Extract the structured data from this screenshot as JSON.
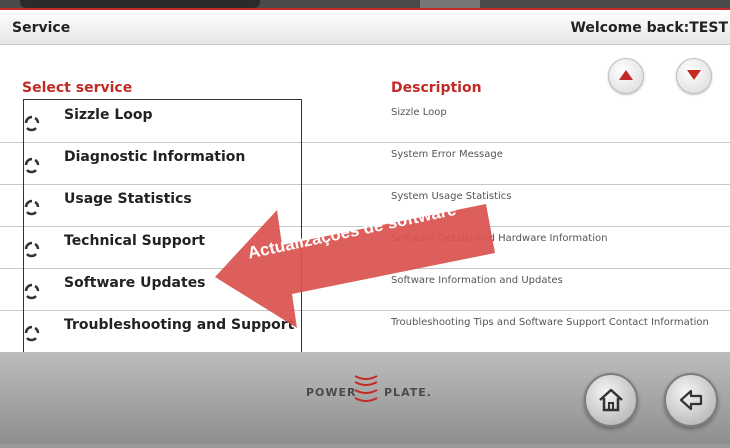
{
  "header": {
    "title": "Service",
    "welcome": "Welcome back:TEST"
  },
  "columns": {
    "service": "Select service",
    "description": "Description"
  },
  "nav": {
    "up_icon": "triangle-up-icon",
    "down_icon": "triangle-down-icon"
  },
  "services": [
    {
      "label": "Sizzle Loop",
      "description": "Sizzle Loop"
    },
    {
      "label": "Diagnostic Information",
      "description": "System Error Message"
    },
    {
      "label": "Usage Statistics",
      "description": "System Usage Statistics"
    },
    {
      "label": "Technical Support",
      "description": "Software Details and Hardware Information"
    },
    {
      "label": "Software Updates",
      "description": "Software Information and Updates"
    },
    {
      "label": "Troubleshooting and Support",
      "description": "Troubleshooting Tips and Software Support Contact Information"
    }
  ],
  "footer": {
    "logo_left": "POWER",
    "logo_right": "PLATE.",
    "home_icon": "home-icon",
    "back_icon": "back-arrow-icon"
  },
  "callout": {
    "text": "Actualizações de software"
  },
  "colors": {
    "accent": "#c22a25",
    "callout": "#d9534f"
  }
}
